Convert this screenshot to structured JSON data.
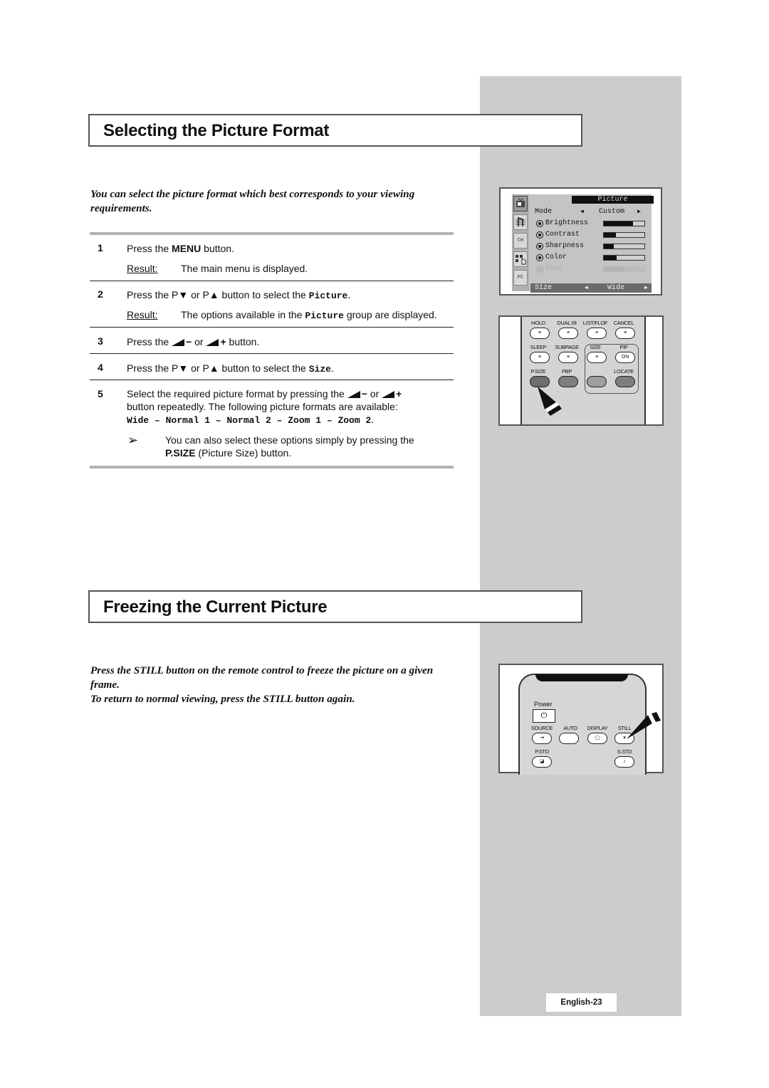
{
  "section1": {
    "title": "Selecting the Picture Format",
    "intro": "You can select the picture format which best corresponds to your viewing requirements.",
    "steps": [
      {
        "num": "1",
        "text_pre": "Press the ",
        "text_bold": "MENU",
        "text_post": " button.",
        "result_label": "Result:",
        "result_text": "The main menu is displayed."
      },
      {
        "num": "2",
        "text_pre": "Press the P▼ or P▲ button to select the ",
        "text_mono": "Picture",
        "text_post": ".",
        "result_label": "Result:",
        "result_pre": "The options available in the ",
        "result_mono": "Picture",
        "result_post": " group are displayed."
      },
      {
        "num": "3",
        "text_pre": "Press the ",
        "text_mid": " or ",
        "text_post": " button.",
        "minus": "−",
        "plus": "+"
      },
      {
        "num": "4",
        "text_pre": "Press the P▼ or P▲ button to select the ",
        "text_mono": "Size",
        "text_post": "."
      },
      {
        "num": "5",
        "text_pre": "Select the required picture format by pressing the ",
        "text_mid": " or ",
        "text_line2": "button repeatedly. The following picture formats are available:",
        "formats": "Wide – Normal 1 – Normal 2 – Zoom 1 – Zoom 2",
        "formats_end": ".",
        "minus": "−",
        "plus": "+"
      }
    ],
    "note": {
      "icon": "➢",
      "text_pre": "You can also select these options simply by pressing the ",
      "text_bold": "P.SIZE",
      "text_post": " (Picture Size) button."
    }
  },
  "osd_menu": {
    "title": "Picture",
    "side_icons": [
      "picture-icon",
      "sound-icon",
      "channel-icon",
      "setup-icon",
      "pc-icon"
    ],
    "side_icon_labels": [
      "",
      "",
      "CH",
      "",
      "PC"
    ],
    "mode": {
      "label": "Mode",
      "value": "Custom",
      "left": "◀",
      "right": "▶"
    },
    "items": [
      {
        "label": "Brightness",
        "level": 0.72,
        "enabled": true
      },
      {
        "label": "Contrast",
        "level": 0.3,
        "enabled": true
      },
      {
        "label": "Sharpness",
        "level": 0.25,
        "enabled": true
      },
      {
        "label": "Color",
        "level": 0.32,
        "enabled": true
      },
      {
        "label": "Tint",
        "level": 0.5,
        "enabled": false
      }
    ],
    "size": {
      "label": "Size",
      "value": "Wide",
      "left": "◀",
      "right": "▶"
    }
  },
  "remote1": {
    "row1": [
      "HOLD",
      "DUAL I/II",
      "LIST/FLOF",
      "CANCEL"
    ],
    "row2": [
      "SLEEP",
      "SUBPAGE",
      "SIZE",
      "PIP"
    ],
    "pip_button": "ON",
    "row3": [
      "P.SIZE",
      "PBP",
      "",
      "LOCATE"
    ]
  },
  "section2": {
    "title": "Freezing the Current Picture",
    "intro1": "Press the STILL button on the remote control to freeze the picture on a given frame.",
    "intro2": "To return to normal viewing, press the STILL button again."
  },
  "remote2": {
    "power": "Power",
    "row1": [
      "SOURCE",
      "AUTO",
      "DISPLAY",
      "STILL"
    ],
    "row2": [
      "P.STD",
      "S.STD"
    ]
  },
  "footer": {
    "page_label": "English-23"
  }
}
